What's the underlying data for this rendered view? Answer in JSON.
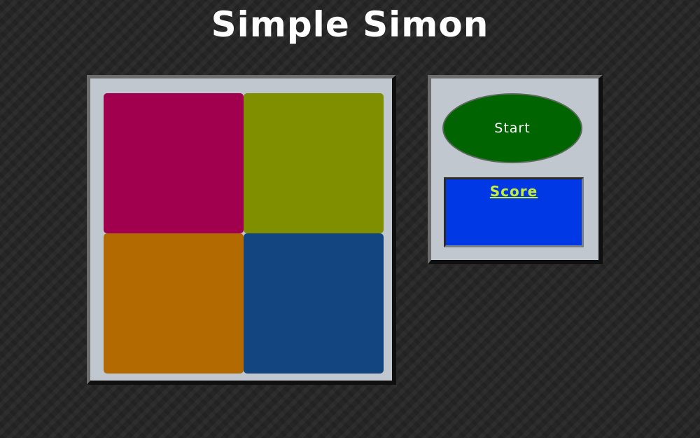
{
  "title": "Simple Simon",
  "board": {
    "pads": [
      {
        "name": "top-left-pad",
        "color": "#a0004e"
      },
      {
        "name": "top-right-pad",
        "color": "#7f8f00"
      },
      {
        "name": "bottom-left-pad",
        "color": "#b36a00"
      },
      {
        "name": "bottom-right-pad",
        "color": "#134680"
      }
    ]
  },
  "controls": {
    "start_label": "Start",
    "start_color": "#006400",
    "score_label": "Score",
    "score_value": "",
    "score_bg_color": "#0038e6",
    "score_text_color": "#c5ee3a"
  }
}
